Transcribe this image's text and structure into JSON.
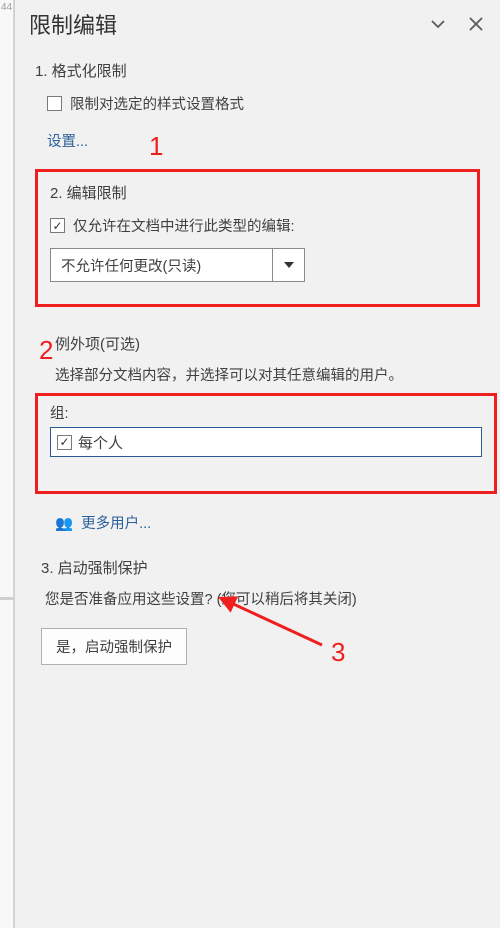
{
  "leftStrip": {
    "num": "44"
  },
  "header": {
    "title": "限制编辑"
  },
  "sec1": {
    "heading": "1. 格式化限制",
    "chkLabel": "限制对选定的样式设置格式",
    "settings": "设置..."
  },
  "sec2": {
    "heading": "2. 编辑限制",
    "chkLabel": "仅允许在文档中进行此类型的编辑:",
    "ddValue": "不允许任何更改(只读)"
  },
  "exceptions": {
    "heading": "例外项(可选)",
    "desc": "选择部分文档内容，并选择可以对其任意编辑的用户。",
    "groupLabel": "组:",
    "groupItem": "每个人",
    "moreUsers": "更多用户..."
  },
  "sec3": {
    "heading": "3. 启动强制保护",
    "prompt": "您是否准备应用这些设置? (您可以稍后将其关闭)",
    "button": "是，启动强制保护"
  },
  "annotations": {
    "n1": "1",
    "n2": "2",
    "n3": "3"
  }
}
